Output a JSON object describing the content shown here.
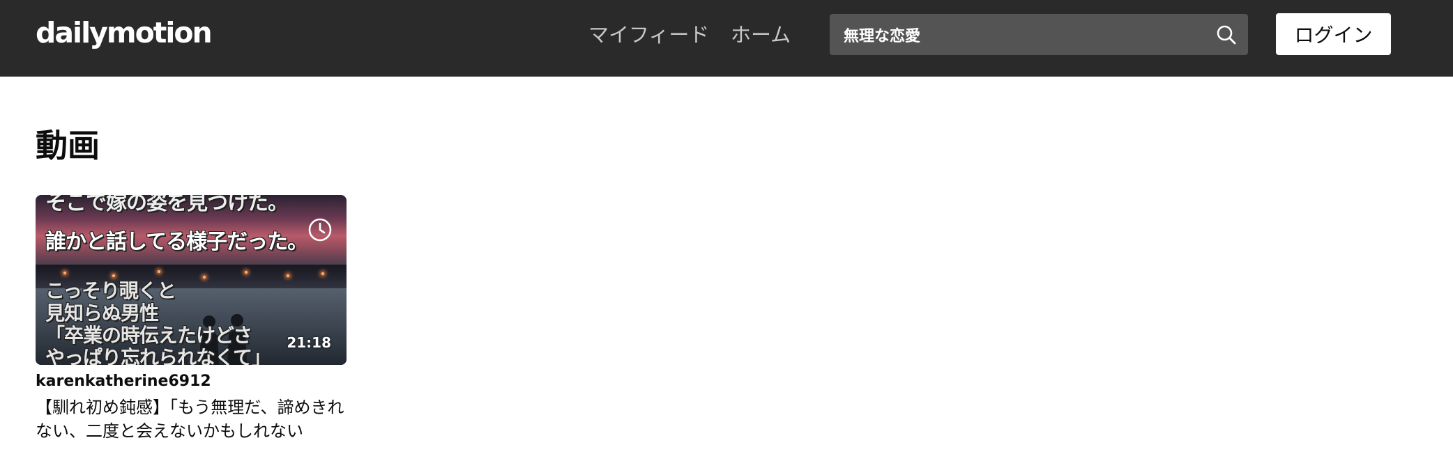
{
  "header": {
    "logo_text": "dailymotion",
    "nav": [
      {
        "label": "マイフィード"
      },
      {
        "label": "ホーム"
      }
    ],
    "search": {
      "value": "無理な恋愛",
      "icon": "search-icon"
    },
    "login_label": "ログイン"
  },
  "main": {
    "section_title": "動画",
    "videos": [
      {
        "thumbnail_text": [
          "そこで嫁の姿を見つけた。",
          "誰かと話してる様子だった。",
          "こっそり覗くと",
          "見知らぬ男性",
          "「卒業の時伝えたけどさ",
          "やっぱり忘れられなくて」"
        ],
        "duration": "21:18",
        "watch_later_icon": "clock-icon",
        "owner": "karenkatherine6912",
        "title": "【馴れ初め鈍感】「もう無理だ、諦めきれない、二度と会えないかもしれない"
      }
    ]
  },
  "colors": {
    "header_bg": "#2a2a2a",
    "search_bg": "#545454",
    "login_bg": "#ffffff",
    "page_bg": "#ffffff"
  }
}
